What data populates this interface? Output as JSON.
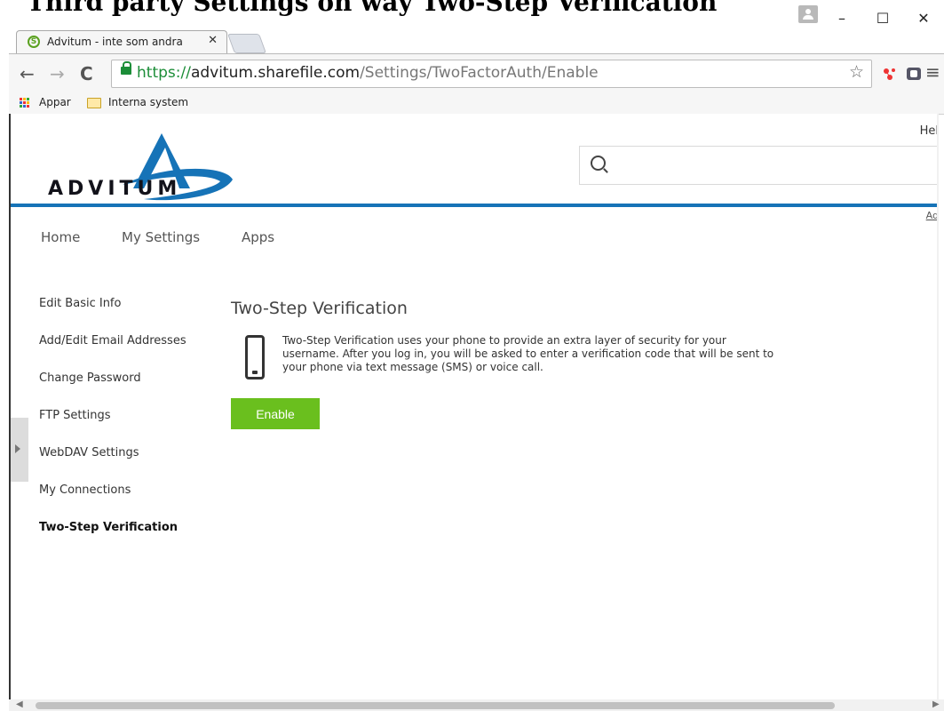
{
  "doc_overlay": {
    "text": "Third party Settings on way Two-Step Verification"
  },
  "window": {
    "minimize": "–",
    "maximize": "☐",
    "close": "✕"
  },
  "tab": {
    "title": "Advitum - inte som andra",
    "close": "✕",
    "favicon": "S"
  },
  "address": {
    "scheme": "https://",
    "host": "advitum.sharefile.com",
    "path": "/Settings/TwoFactorAuth/Enable"
  },
  "bookmarks": {
    "apps": "Appar",
    "folder": "Interna system"
  },
  "header": {
    "logo_text": "ADVITUM",
    "hello": "Hel",
    "ad_link": "Ad"
  },
  "topnav": {
    "items": [
      "Home",
      "My Settings",
      "Apps"
    ]
  },
  "sidenav": {
    "items": [
      "Edit Basic Info",
      "Add/Edit Email Addresses",
      "Change Password",
      "FTP Settings",
      "WebDAV Settings",
      "My Connections",
      "Two-Step Verification"
    ]
  },
  "content": {
    "title": "Two-Step Verification",
    "description": "Two-Step Verification uses your phone to provide an extra layer of security for your username. After you log in, you will be asked to enter a verification code that will be sent to your phone via text message (SMS) or voice call.",
    "enable_label": "Enable"
  },
  "colors": {
    "accent_blue": "#1673b7",
    "enable_green": "#6abf1e",
    "secure_green": "#1c8d38"
  },
  "icons": [
    "search-icon",
    "phone-icon",
    "lock-icon",
    "star-icon",
    "apps-icon",
    "folder-icon"
  ]
}
